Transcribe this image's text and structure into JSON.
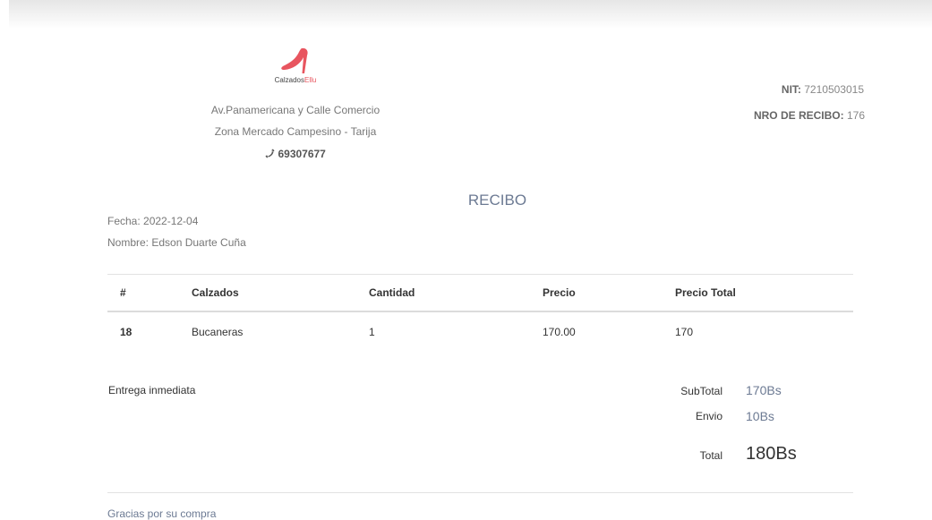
{
  "company": {
    "logo_name": "Calzados",
    "logo_accent": "Ellu",
    "address_line1": "Av.Panamericana y Calle Comercio",
    "address_line2": "Zona Mercado Campesino - Tarija",
    "phone": "69307677",
    "phone_icon": "phone-icon"
  },
  "receipt_info": {
    "nit_label": "NIT:",
    "nit_value": "7210503015",
    "nro_label": "NRO DE RECIBO:",
    "nro_value": "176"
  },
  "title": "RECIBO",
  "customer": {
    "fecha": "Fecha: 2022-12-04",
    "nombre": "Nombre: Edson Duarte Cuña"
  },
  "table": {
    "headers": [
      "#",
      "Calzados",
      "Cantidad",
      "Precio",
      "Precio Total"
    ],
    "rows": [
      [
        "18",
        "Bucaneras",
        "1",
        "170.00",
        "170"
      ]
    ]
  },
  "note": "Entrega inmediata",
  "totals": {
    "subtotal_label": "SubTotal",
    "subtotal_value": "170Bs",
    "envio_label": "Envio",
    "envio_value": "10Bs",
    "total_label": "Total",
    "total_value": "180Bs"
  },
  "footer": "Gracias por su compra",
  "colors": {
    "accent": "#6c7a93",
    "logo_red": "#e8555f"
  }
}
